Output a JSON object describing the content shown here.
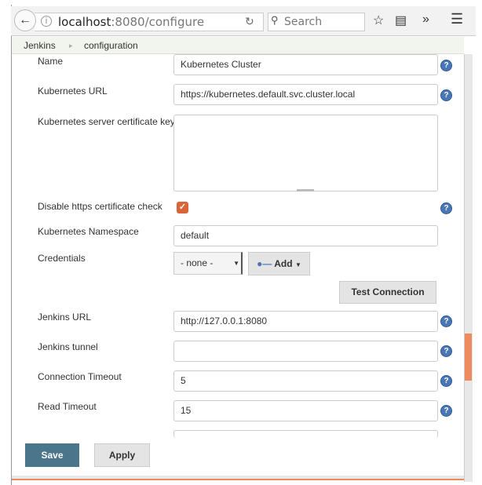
{
  "browser": {
    "url_host": "localhost",
    "url_rest": ":8080/configure",
    "search_placeholder": "Search"
  },
  "breadcrumb": [
    "Jenkins",
    "configuration"
  ],
  "form": {
    "name": {
      "label": "Name",
      "value": "Kubernetes Cluster"
    },
    "kubernetes_url": {
      "label": "Kubernetes URL",
      "value": "https://kubernetes.default.svc.cluster.local"
    },
    "cert_key": {
      "label": "Kubernetes server certificate key",
      "value": ""
    },
    "disable_https": {
      "label": "Disable https certificate check",
      "checked": true
    },
    "namespace": {
      "label": "Kubernetes Namespace",
      "value": "default"
    },
    "credentials": {
      "label": "Credentials",
      "selected": "- none -",
      "add_label": "Add"
    },
    "test_connection": "Test Connection",
    "jenkins_url": {
      "label": "Jenkins URL",
      "value": "http://127.0.0.1:8080"
    },
    "jenkins_tunnel": {
      "label": "Jenkins tunnel",
      "value": ""
    },
    "connection_timeout": {
      "label": "Connection Timeout",
      "value": "5"
    },
    "read_timeout": {
      "label": "Read Timeout",
      "value": "15"
    }
  },
  "buttons": {
    "save": "Save",
    "apply": "Apply"
  },
  "colors": {
    "save": "#4b758b",
    "checkbox": "#d9643a",
    "scroll_thumb": "#ef8a5e",
    "help": "#4a77b4"
  }
}
